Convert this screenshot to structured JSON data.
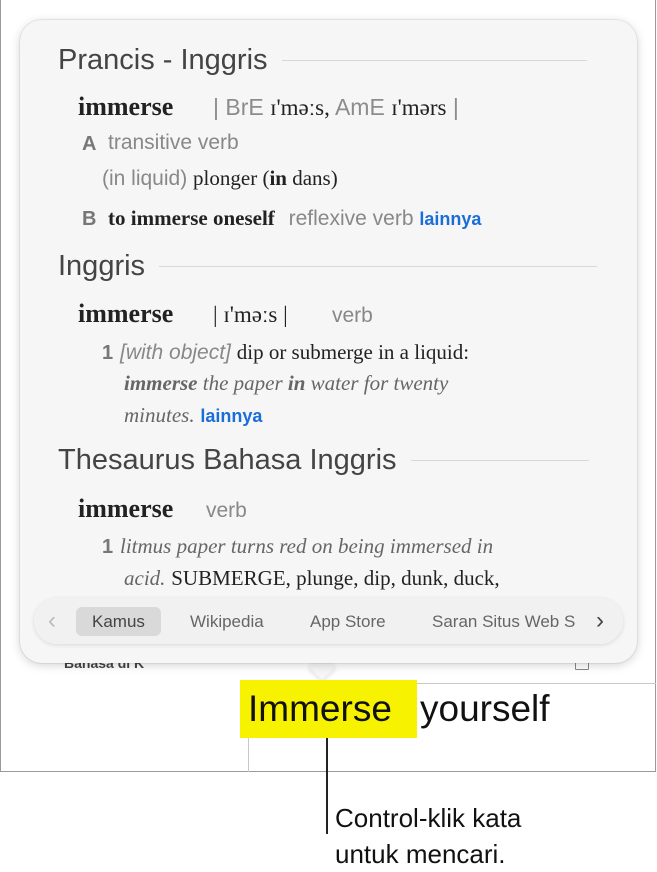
{
  "sections": {
    "s1": {
      "heading": "Prancis - Inggris",
      "headword": "immerse",
      "pron_bre_label": "| BrE",
      "pron_bre_ipa": "ɪ'məːs,",
      "pron_ame_label": "AmE",
      "pron_ame_ipa": "ɪ'mərs",
      "pron_close": "|",
      "sense_a_letter": "A",
      "sense_a_pos": "transitive verb",
      "sense_a_context": "(in liquid)",
      "sense_a_t1": "plonger (",
      "sense_a_t2": "in",
      "sense_a_t3": " dans)",
      "sense_b_letter": "B",
      "sense_b_phrase": "to immerse oneself",
      "sense_b_pos": "reflexive verb",
      "more_link": "lainnya"
    },
    "s2": {
      "heading": "Inggris",
      "headword": "immerse",
      "pron": "| ɪ'məːs |",
      "pos": "verb",
      "sense_num": "1",
      "sense_gram": "[with object]",
      "sense_def": "dip or submerge in a liquid:",
      "ex_1": "immerse",
      "ex_2": " the paper ",
      "ex_3": "in",
      "ex_4": " water for twenty",
      "ex_5": "minutes.",
      "more_link": "lainnya"
    },
    "s3": {
      "heading": "Thesaurus Bahasa Inggris",
      "headword": "immerse",
      "pos": "verb",
      "sense_num": "1",
      "ex_line1": "litmus paper turns red on being immersed in",
      "ex_line2": "acid.",
      "synonyms": "SUBMERGE, plunge, dip, dunk, duck,"
    }
  },
  "tabs": {
    "kamus": "Kamus",
    "wikipedia": "Wikipedia",
    "app_store": "App Store",
    "saran": "Saran Situs Web S"
  },
  "document": {
    "word1": "Immerse",
    "word2": "yourself"
  },
  "callout": {
    "line1": "Control-klik kata",
    "line2": "untuk mencari."
  },
  "icons": {
    "prev": "chevron-left-icon",
    "next": "chevron-right-icon"
  },
  "colors": {
    "highlight": "#f6f200",
    "link": "#1b6ed8"
  }
}
